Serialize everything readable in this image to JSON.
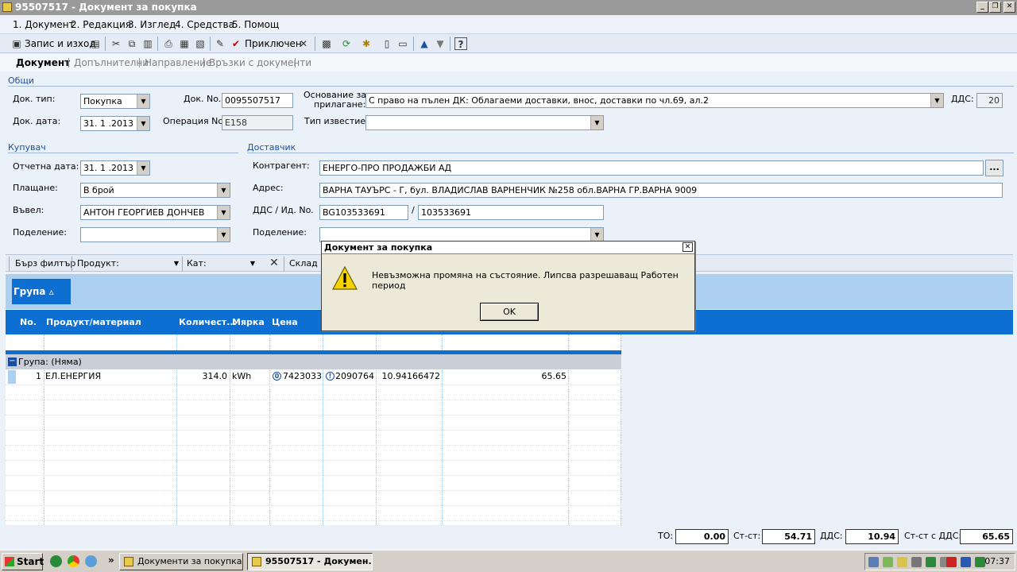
{
  "window": {
    "title": "95507517 - Документ за покупка"
  },
  "menu": [
    "1. Документ",
    "2. Редакция",
    "3. Изглед",
    "4. Средства",
    "5. Помощ"
  ],
  "toolbar": {
    "save_exit": "Запис и изход",
    "close_doc": "Приключен"
  },
  "tabs": [
    "Документ",
    "Допълнителни",
    "Направление",
    "Връзки с документи"
  ],
  "general": {
    "section": "Общи",
    "doc_type_label": "Док. тип:",
    "doc_type": "Покупка",
    "doc_no_label": "Док. No.",
    "doc_no": "0095507517",
    "basis_label_1": "Основание за",
    "basis_label_2": "прилагане:",
    "basis": "С право на пълен ДК: Облагаеми доставки, внос, доставки по чл.69, ал.2",
    "vat_label": "ДДС:",
    "vat": "20",
    "doc_date_label": "Док. дата:",
    "doc_date": "31. 1 .2013",
    "op_no_label": "Операция No.",
    "op_no": "E158",
    "notice_type_label": "Тип известие:",
    "notice_type": ""
  },
  "buyer": {
    "section": "Купувач",
    "report_date_label": "Отчетна дата:",
    "report_date": "31. 1 .2013",
    "payment_label": "Плащане:",
    "payment": "В брой",
    "entered_label": "Въвел:",
    "entered": "АНТОН ГЕОРГИЕВ ДОНЧЕВ",
    "division_label": "Поделение:",
    "division": ""
  },
  "supplier": {
    "section": "Доставчик",
    "partner_label": "Контрагент:",
    "partner": "ЕНЕРГО-ПРО ПРОДАЖБИ АД",
    "more": "...",
    "address_label": "Адрес:",
    "address": "ВАРНА ТАУЪРС - Г, бул. ВЛАДИСЛАВ ВАРНЕНЧИК  №258 обл.ВАРНА ГР.ВАРНА 9009",
    "vat_id_label": "ДДС / Ид. No.",
    "vat_no": "BG103533691",
    "slash": "/",
    "id_no": "103533691",
    "division_label": "Поделение:",
    "division": ""
  },
  "filter": {
    "quick": "Бърз филтър",
    "product_label": "Продукт:",
    "cat_label": "Кат:",
    "store": "Склад"
  },
  "grid": {
    "group_chip": "Группа",
    "group_chip_text": "Група ▵",
    "columns": [
      "No.",
      "Продукт/материал",
      "Количест...",
      "Мярка",
      "Цена"
    ],
    "group_row": "Група: (Няма)",
    "rows": [
      {
        "no": "1",
        "product": "ЕЛ.ЕНЕРГИЯ",
        "qty": "314.0",
        "unit": "kWh",
        "price": "0.17423033",
        "col6": "0.2090764",
        "col7": "10.94166472",
        "col9": "65.65"
      }
    ]
  },
  "totals": {
    "to_label": "ТО:",
    "to": "0.00",
    "net_label": "Ст-ст:",
    "net": "54.71",
    "vat_label": "ДДС:",
    "vat": "10.94",
    "gross_label": "Ст-ст с ДДС:",
    "gross": "65.65"
  },
  "dialog": {
    "title": "Документ за покупка",
    "message": "Невъзможна промяна на състояние. Липсва разрешаващ Работен период",
    "ok": "OK"
  },
  "taskbar": {
    "start": "Start",
    "task1": "Документи за покупка ...",
    "task2": "95507517 - Докумен...",
    "clock": "07:37"
  }
}
